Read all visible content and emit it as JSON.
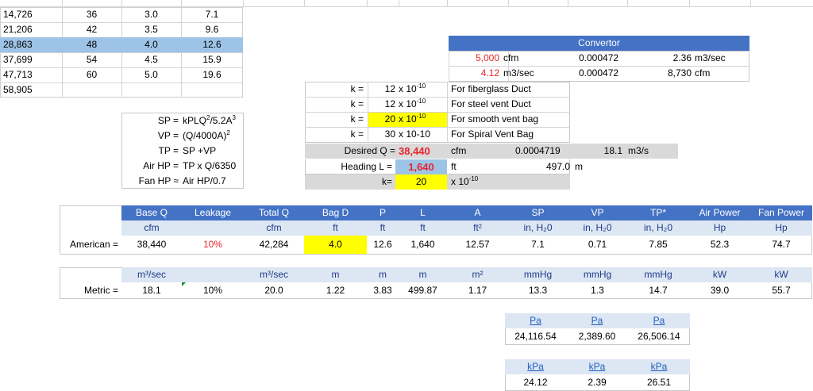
{
  "top_table": {
    "rows": [
      {
        "q": "14,726",
        "d": "36",
        "d2": "3.0",
        "a": "7.1"
      },
      {
        "q": "21,206",
        "d": "42",
        "d2": "3.5",
        "a": "9.6"
      },
      {
        "q": "28,863",
        "d": "48",
        "d2": "4.0",
        "a": "12.6"
      },
      {
        "q": "37,699",
        "d": "54",
        "d2": "4.5",
        "a": "15.9"
      },
      {
        "q": "47,713",
        "d": "60",
        "d2": "5.0",
        "a": "19.6"
      },
      {
        "q": "58,905",
        "d": "",
        "d2": "",
        "a": ""
      }
    ],
    "highlight_color": "#9dc3e6"
  },
  "convertor": {
    "title": "Convertor",
    "row1": {
      "val": "5,000",
      "unit": "cfm",
      "factor": "0.000472",
      "result": "2.36",
      "runit": "m3/sec"
    },
    "row2": {
      "val": "4.12",
      "unit": "m3/sec",
      "factor": "0.000472",
      "result": "8,730",
      "runit": "cfm"
    }
  },
  "k_table": {
    "rows": [
      {
        "k": "k =",
        "val": "12",
        "mult": "x 10",
        "exp": "-10",
        "desc": "For fiberglass Duct"
      },
      {
        "k": "k =",
        "val": "12",
        "mult": "x 10",
        "exp": "-10",
        "desc": "For steel vent Duct"
      },
      {
        "k": "k =",
        "val": "20",
        "mult": "x 10",
        "exp": "-10",
        "desc": "For smooth vent bag"
      },
      {
        "k": "k =",
        "val": "30",
        "mult": "x 10-10",
        "exp": "",
        "desc": "For Spiral Vent Bag"
      }
    ],
    "desired_label": "Desired Q =",
    "desired_val": "38,440",
    "desired_unit": "cfm",
    "desired_factor": "0.0004719",
    "desired_result": "18.1",
    "desired_runit": "m3/s",
    "heading_label": "Heading L =",
    "heading_val": "1,640",
    "heading_unit": "ft",
    "heading_result": "497.0",
    "heading_runit": "m",
    "k_label": "k=",
    "k_val": "20",
    "k_mult": "x 10",
    "k_exp": "-10"
  },
  "formulas": {
    "rows": [
      {
        "lhs": "SP =",
        "rhs": "kPLQ",
        "rhs_sup": "2",
        "rhs2": "/5.2A",
        "rhs2_sup": "3"
      },
      {
        "lhs": "VP =",
        "rhs": "(Q/4000A)",
        "rhs_sup": "2",
        "rhs2": "",
        "rhs2_sup": ""
      },
      {
        "lhs": "TP =",
        "rhs": "SP +VP",
        "rhs_sup": "",
        "rhs2": "",
        "rhs2_sup": ""
      },
      {
        "lhs": "Air HP =",
        "rhs": "TP x Q/6350",
        "rhs_sup": "",
        "rhs2": "",
        "rhs2_sup": ""
      },
      {
        "lhs": "Fan HP ≈",
        "rhs": "Air HP/0.7",
        "rhs_sup": "",
        "rhs2": "",
        "rhs2_sup": ""
      }
    ]
  },
  "main_table": {
    "headers": [
      "Base Q",
      "Leakage",
      "Total Q",
      "Bag D",
      "P",
      "L",
      "A",
      "SP",
      "VP",
      "TP*",
      "Air Power",
      "Fan Power"
    ],
    "units": [
      "cfm",
      "",
      "cfm",
      "ft",
      "ft",
      "ft",
      "ft²",
      "in, H₂0",
      "in, H₂0",
      "in, H₂0",
      "Hp",
      "Hp"
    ],
    "american_label": "American =",
    "american": [
      "38,440",
      "10%",
      "42,284",
      "4.0",
      "12.6",
      "1,640",
      "12.57",
      "7.1",
      "0.71",
      "7.85",
      "52.3",
      "74.7"
    ],
    "metric_units": [
      "m³/sec",
      "",
      "m³/sec",
      "m",
      "m",
      "m",
      "m²",
      "mmHg",
      "mmHg",
      "mmHg",
      "kW",
      "kW"
    ],
    "metric_label": "Metric =",
    "metric": [
      "18.1",
      "10%",
      "20.0",
      "1.22",
      "3.83",
      "499.87",
      "1.17",
      "13.3",
      "1.3",
      "14.7",
      "39.0",
      "55.7"
    ]
  },
  "pa_table": {
    "headers": [
      "Pa",
      "Pa",
      "Pa"
    ],
    "values": [
      "24,116.54",
      "2,389.60",
      "26,506.14"
    ]
  },
  "kpa_table": {
    "headers": [
      "kPa",
      "kPa",
      "kPa"
    ],
    "values": [
      "24.12",
      "2.39",
      "26.51"
    ]
  }
}
